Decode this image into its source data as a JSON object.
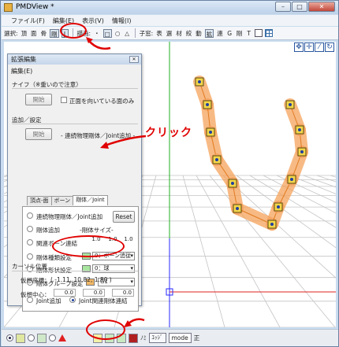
{
  "window": {
    "title": "PMDView *",
    "min": "–",
    "max": "□",
    "close": "✕"
  },
  "menubar": [
    "ファイル(F)",
    "編集(E)",
    "表示(V)",
    "情報(I)"
  ],
  "toolbar": {
    "select_label": "選択:",
    "select_items": [
      "頂",
      "面",
      "骨",
      "剛",
      "J"
    ],
    "render_label": "描画:",
    "render_items": [
      "・",
      "□",
      "○",
      "△"
    ],
    "subwin_label": "子窓:",
    "subwin_items": [
      "表",
      "選",
      "材",
      "絞",
      "動",
      "拡",
      "連",
      "G",
      "剛",
      "T"
    ]
  },
  "nav_icons": [
    "✥",
    "✛",
    "⁄",
    "↻"
  ],
  "dialog": {
    "title": "拡張編集",
    "close": "✕",
    "menu": "編集(E)",
    "knife": {
      "group": "ナイフ（※重いので注意）",
      "start_button": "開始",
      "front_only": "正面を向いている面のみ"
    },
    "append": {
      "group": "追加／設定",
      "start_button": "開始",
      "mode_text": "- 連続物理剛体／Joint追加 -"
    },
    "tabs": [
      "頂点-面",
      "ボーン",
      "剛体／Joint"
    ],
    "panel": {
      "options": [
        "連続物理剛体／Joint追加",
        "剛体追加",
        "関連ボーン連結",
        "剛体種類設定",
        "剛体形状設定",
        "剛体グループ設定",
        "Joint追加",
        "Joint関連剛体連結"
      ],
      "reset_button": "Reset",
      "size_label": "-剛体サイズ-",
      "size_values": [
        "1.0",
        "1.0",
        "1.0"
      ],
      "type_select": "0：ボーン追従",
      "shape_select": "0：球",
      "group_select": "G1",
      "type_color": "#a8e6a0",
      "shape_color": "#a8e6a0",
      "group_color": "#f0b868"
    },
    "cursor": {
      "group": "カーソル位置",
      "virtual_coord_label": "仮想座標：",
      "virtual_coord_value": "( -1.11, 10.82, 1.80 )",
      "virtual_center_label": "仮想中心：",
      "center_values": [
        "0.0",
        "0.0",
        "0.0"
      ]
    }
  },
  "annotation": {
    "click_label": "クリック"
  },
  "statusbar": {
    "mode_select": "mode",
    "right_label": "正",
    "buttons": [
      "ﾉﾐ",
      "ｴｯｼﾞ"
    ]
  }
}
